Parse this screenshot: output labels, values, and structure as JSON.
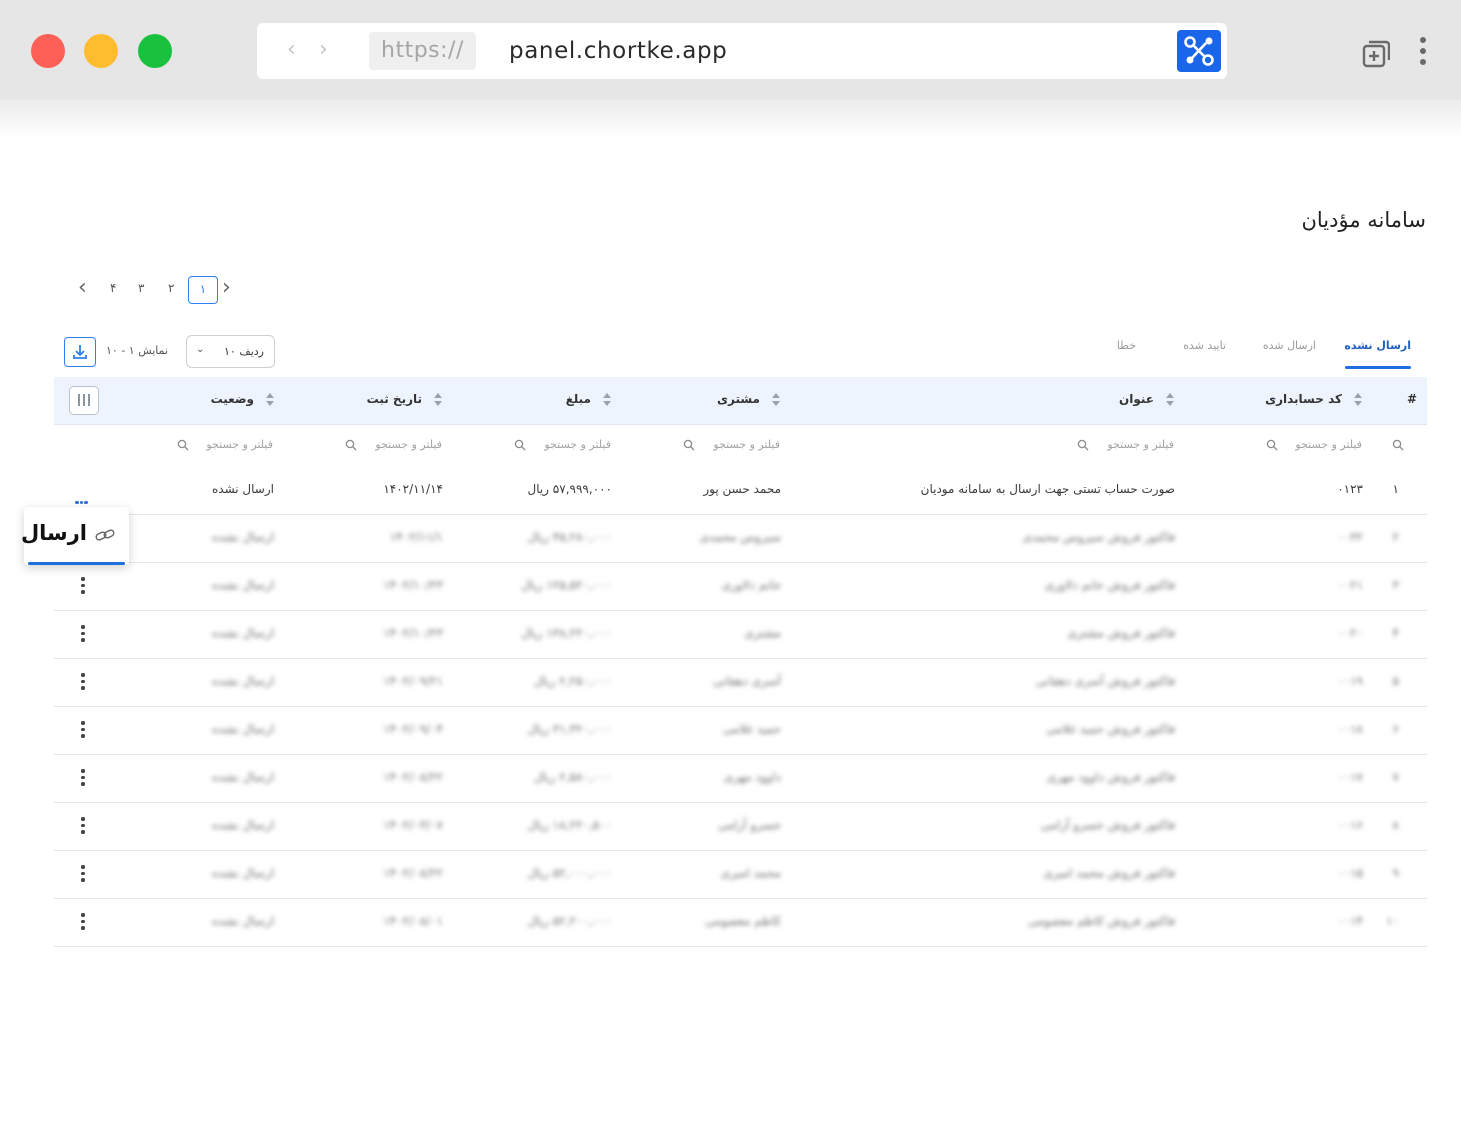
{
  "browser": {
    "scheme": "https://",
    "host": "panel.chortke.app",
    "back_icon": "chevron-left-icon",
    "forward_icon": "chevron-right-icon",
    "new_tab_icon": "new-tab-icon",
    "menu_icon": "kebab-menu-icon",
    "brand_color": "#1a66e8"
  },
  "page": {
    "title": "سامانه مؤدیان"
  },
  "pagination": {
    "pages": [
      "۱",
      "۲",
      "۳",
      "۴"
    ],
    "current": "۱"
  },
  "toolbar": {
    "showing_text": "نمایش ۱ - ۱۰",
    "rows_label": "ردیف ۱۰"
  },
  "tabs": [
    {
      "label": "ارسال نشده",
      "active": true
    },
    {
      "label": "ارسال شده",
      "active": false
    },
    {
      "label": "تایید شده",
      "active": false
    },
    {
      "label": "خطا",
      "active": false
    }
  ],
  "table": {
    "columns": {
      "index": "#",
      "code": "کد حسابداری",
      "title": "عنوان",
      "customer": "مشتری",
      "amount": "مبلغ",
      "date": "تاریخ ثبت",
      "status": "وضعیت"
    },
    "filter_placeholder": "فیلتر و جستجو",
    "rows": [
      {
        "index": "۱",
        "code": "۰۱۲۳",
        "title": "صورت حساب تستی جهت ارسال به سامانه مودیان",
        "customer": "محمد حسن پور",
        "amount": "۵۷,۹۹۹,۰۰۰ ریال",
        "date": "۱۴۰۲/۱۱/۱۴",
        "status": "ارسال نشده"
      },
      {
        "index": "۲",
        "code": "۰۰۳۲",
        "title": "فاکتور فروش سیروس محمدی",
        "customer": "سیروس محمدی",
        "amount": "۴۵,۲۸۰,۰۰۰ ریال",
        "date": "۱۴۰۲/۱۱/۱",
        "status": "ارسال نشده"
      },
      {
        "index": "۳",
        "code": "۰۰۲۱",
        "title": "فاکتور فروش خانم دلاوری",
        "customer": "خانم دلاوری",
        "amount": "۱۲۵,۵۲۰,۰۰۰ ریال",
        "date": "۱۴۰۲/۱۰/۲۳",
        "status": "ارسال نشده"
      },
      {
        "index": "۴",
        "code": "۰۰۲۰",
        "title": "فاکتور فروش مشتری",
        "customer": "مشتری",
        "amount": "۱۳۸,۲۲۰,۰۰۰ ریال",
        "date": "۱۴۰۲/۱۰/۲۳",
        "status": "ارسال نشده"
      },
      {
        "index": "۵",
        "code": "۰۰۱۹",
        "title": "فاکتور فروش آسری دهقانی",
        "customer": "آسری دهقانی",
        "amount": "۲,۲۵۰,۰۰۰ ریال",
        "date": "۱۴۰۲/۰۹/۲۱",
        "status": "ارسال نشده"
      },
      {
        "index": "۶",
        "code": "۰۰۱۸",
        "title": "فاکتور فروش حمید غلامی",
        "customer": "حمید غلامی",
        "amount": "۳۱,۳۲۰,۰۰۰ ریال",
        "date": "۱۴۰۲/۰۹/۰۴",
        "status": "ارسال نشده"
      },
      {
        "index": "۷",
        "code": "۰۰۱۷",
        "title": "فاکتور فروش داوود مهری",
        "customer": "داوود مهری",
        "amount": "۲,۵۸۰,۰۰۰ ریال",
        "date": "۱۴۰۲/۰۸/۲۲",
        "status": "ارسال نشده"
      },
      {
        "index": "۸",
        "code": "۰۰۱۶",
        "title": "فاکتور فروش خسرو آرامی",
        "customer": "خسرو آرامی",
        "amount": "۱۸,۲۲۰,۵۰۰ ریال",
        "date": "۱۴۰۲/۰۳/۰۷",
        "status": "ارسال نشده"
      },
      {
        "index": "۹",
        "code": "۰۰۱۵",
        "title": "فاکتور فروش محمد امیری",
        "customer": "محمد امیری",
        "amount": "۵۲,۰۰۰,۰۰۰ ریال",
        "date": "۱۴۰۲/۰۸/۲۲",
        "status": "ارسال نشده"
      },
      {
        "index": "۱۰",
        "code": "۰۰۱۴",
        "title": "فاکتور فروش کاظم معصومی",
        "customer": "کاظم معصومی",
        "amount": "۵۲,۲۰۰,۰۰۰ ریال",
        "date": "۱۴۰۲/۰۸/۰۱",
        "status": "ارسال نشده"
      }
    ]
  },
  "popup": {
    "label": "ارسال",
    "icon": "send-link-icon"
  },
  "colors": {
    "accent": "#1f6fe0",
    "header_bg": "#eef4fd"
  }
}
